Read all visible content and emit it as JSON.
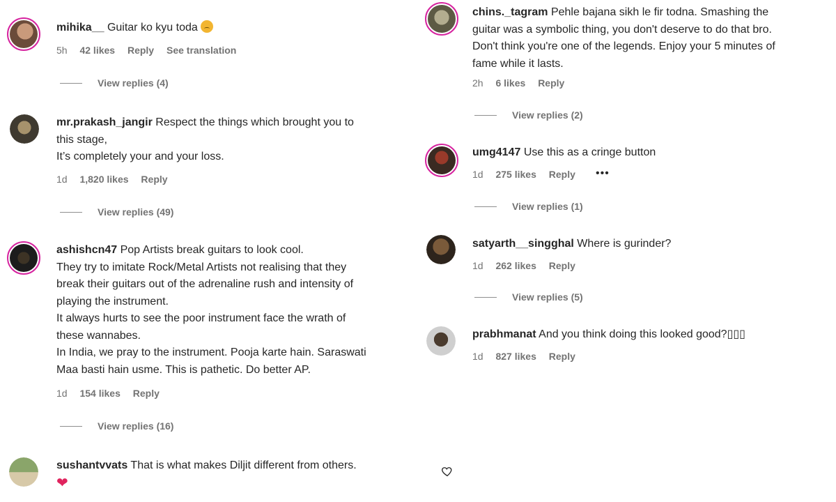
{
  "left": [
    {
      "username": "mihika__",
      "text": "Guitar ko kyu toda",
      "emoji": "sad-face-emoji",
      "time": "5h",
      "likes": "42 likes",
      "reply": "Reply",
      "translate": "See translation",
      "view_replies": "View replies (4)",
      "avatar_colors": [
        "#6b4b3a",
        "#c99a7b"
      ]
    },
    {
      "username": "mr.prakash_jangir",
      "text_line1": "Respect the things which brought you to",
      "text_line2": "this stage,",
      "text_line3": "It’s completely your and your loss.",
      "time": "1d",
      "likes": "1,820 likes",
      "reply": "Reply",
      "view_replies": "View replies (49)",
      "avatar_colors": [
        "#3f3a30",
        "#a6926c"
      ]
    },
    {
      "username": "ashishcn47",
      "lines": [
        "Pop Artists break guitars to look cool.",
        "They try to imitate Rock/Metal Artists not realising that they",
        "break their guitars out of the adrenaline rush and intensity of",
        "playing the instrument.",
        "It always hurts to see the poor instrument face the wrath of",
        "these wannabes.",
        "In India, we pray to the instrument. Pooja karte hain. Saraswati",
        "Maa basti hain usme. This is pathetic. Do better AP."
      ],
      "time": "1d",
      "likes": "154 likes",
      "reply": "Reply",
      "view_replies": "View replies (16)",
      "avatar_colors": [
        "#1c1c1c",
        "#3d3325"
      ]
    },
    {
      "username": "sushantvvats",
      "text": "That is what makes Diljit different from others.",
      "emoji": "red-heart-emoji",
      "heart_glyph": "❤",
      "avatar_colors": [
        "#8aa56a",
        "#d7c9a8"
      ]
    }
  ],
  "right": [
    {
      "username": "chins._tagram",
      "lines": [
        "Pehle bajana sikh le fir todna. Smashing the",
        "guitar was a symbolic thing, you don't deserve to do that bro.",
        "Don't think you're one of the legends. Enjoy your 5 minutes of",
        "fame while it lasts."
      ],
      "time": "2h",
      "likes": "6 likes",
      "reply": "Reply",
      "view_replies": "View replies (2)",
      "avatar_colors": [
        "#b3ad8f",
        "#5d5a44"
      ]
    },
    {
      "username": "umg4147",
      "text": "Use this as a cringe button",
      "time": "1d",
      "likes": "275 likes",
      "reply": "Reply",
      "more": "•••",
      "view_replies": "View replies (1)",
      "avatar_colors": [
        "#9a3a2a",
        "#3a2a22"
      ]
    },
    {
      "username": "satyarth__singghal",
      "text": "Where is gurinder?",
      "time": "1d",
      "likes": "262 likes",
      "reply": "Reply",
      "view_replies": "View replies (5)",
      "avatar_colors": [
        "#7a5a3a",
        "#2d241c"
      ]
    },
    {
      "username": "prabhmanat",
      "text": "And you think doing this looked good?▯▯▯",
      "time": "1d",
      "likes": "827 likes",
      "reply": "Reply",
      "avatar_colors": [
        "#cfcfcf",
        "#4a3b2e"
      ]
    }
  ],
  "icons": {
    "like": "heart-outline-icon"
  },
  "colors": {
    "text": "#262626",
    "meta": "#737373",
    "story_ring": "#d6249f"
  }
}
